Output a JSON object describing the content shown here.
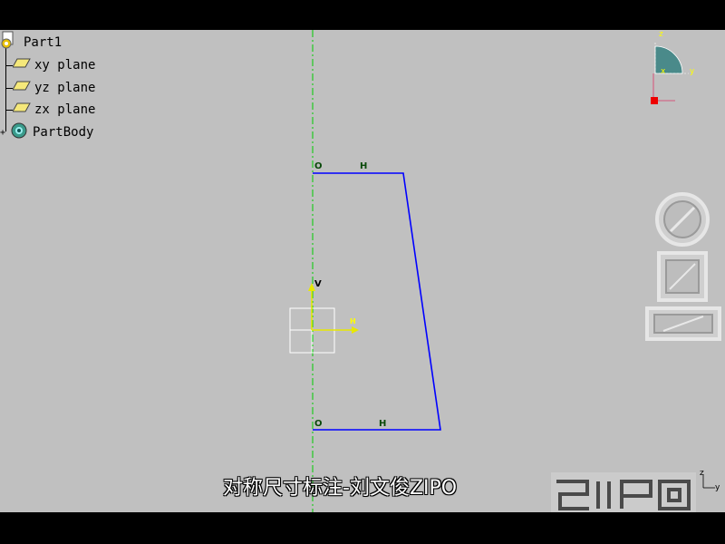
{
  "tree": {
    "root": "Part1",
    "items": [
      {
        "label": "xy plane"
      },
      {
        "label": "yz plane"
      },
      {
        "label": "zx plane"
      },
      {
        "label": "PartBody"
      }
    ]
  },
  "sketch": {
    "axis_v_label": "V",
    "axis_h_label": "H",
    "constraints": [
      {
        "text": "O"
      },
      {
        "text": "H"
      },
      {
        "text": "O"
      },
      {
        "text": "H"
      }
    ]
  },
  "compass": {
    "z_label": "z",
    "x_label": "x",
    "y_label": "y"
  },
  "mini_axis": {
    "z_label": "z",
    "y_label": "y"
  },
  "caption": "对称尺寸标注-刘文俊ZIPO",
  "colors": {
    "profile": "#0000ff",
    "axis": "#00cc00",
    "sketch_axes": "#e8e800",
    "background": "#c0c0c0"
  }
}
